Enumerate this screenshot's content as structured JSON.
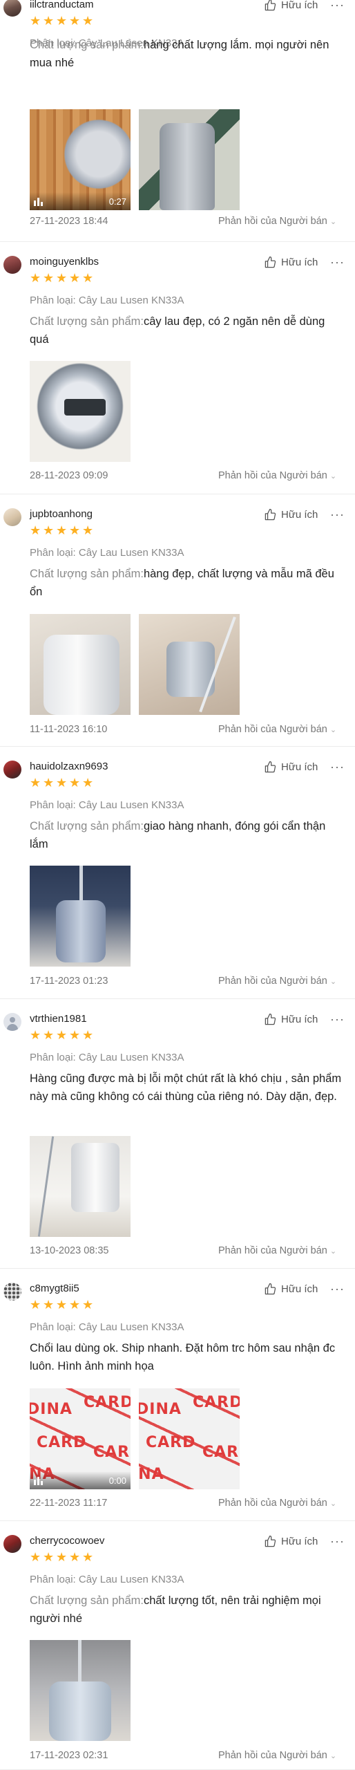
{
  "product_variant": "Phân loại: Cây Lau Lusen KN33A",
  "quality_label": "Chất lượng sản phẩm:",
  "like_label": "Hữu ích",
  "more_label": "···",
  "reply_label": "Phản hồi của Người bán",
  "star_color": "#fdb022",
  "reviews": [
    {
      "username": "iilctranductam",
      "rating": 5,
      "stars": [
        "★",
        "★",
        "★",
        "★",
        "★"
      ],
      "quality_text": "hàng chất lượng lắm. mọi người nên mua nhé",
      "media": [
        {
          "type": "video",
          "duration": "0:27",
          "thumb": "floor"
        },
        {
          "type": "image",
          "thumb": "bucket1"
        }
      ],
      "date": "27-11-2023 18:44"
    },
    {
      "username": "moinguyenklbs",
      "rating": 5,
      "stars": [
        "★",
        "★",
        "★",
        "★",
        "★"
      ],
      "quality_text": "cây lau đẹp, có 2 ngăn nên dễ dùng quá",
      "media": [
        {
          "type": "image",
          "thumb": "lid"
        }
      ],
      "date": "28-11-2023 09:09"
    },
    {
      "username": "jupbtoanhong",
      "rating": 5,
      "stars": [
        "★",
        "★",
        "★",
        "★",
        "★"
      ],
      "quality_text": "hàng đẹp, chất lượng và mẫu mã đều ổn",
      "media": [
        {
          "type": "image",
          "thumb": "bucket2"
        },
        {
          "type": "image",
          "thumb": "mop"
        }
      ],
      "date": "11-11-2023 16:10"
    },
    {
      "username": "hauidolzaxn9693",
      "rating": 5,
      "stars": [
        "★",
        "★",
        "★",
        "★",
        "★"
      ],
      "quality_text": "giao hàng nhanh, đóng gói cẩn thận lắm",
      "media": [
        {
          "type": "image",
          "thumb": "blue"
        }
      ],
      "date": "17-11-2023 01:23"
    },
    {
      "username": "vtrthien1981",
      "rating": 5,
      "stars": [
        "★",
        "★",
        "★",
        "★",
        "★"
      ],
      "comment": "Hàng cũng được mà bị lỗi một chút rất là khó chịu , sản phẩm này mà cũng không có cái thùng của riêng nó. Dày dặn, đẹp.",
      "media": [
        {
          "type": "image",
          "thumb": "white"
        }
      ],
      "date": "13-10-2023 08:35"
    },
    {
      "username": "c8mygt8ii5",
      "rating": 5,
      "stars": [
        "★",
        "★",
        "★",
        "★",
        "★"
      ],
      "comment": "Chổi lau dùng ok. Ship nhanh. Đặt hôm trc hôm sau nhận đc luôn. Hình ảnh minh họa",
      "media": [
        {
          "type": "video",
          "duration": "0:00",
          "thumb": "brand"
        },
        {
          "type": "image",
          "thumb": "brand"
        }
      ],
      "date": "22-11-2023 11:17"
    },
    {
      "username": "cherrycocowoev",
      "rating": 5,
      "stars": [
        "★",
        "★",
        "★",
        "★",
        "★"
      ],
      "quality_text": "chất lượng tốt, nên trải nghiệm mọi người nhé",
      "media": [
        {
          "type": "image",
          "thumb": "grey"
        }
      ],
      "date": "17-11-2023 02:31"
    }
  ]
}
